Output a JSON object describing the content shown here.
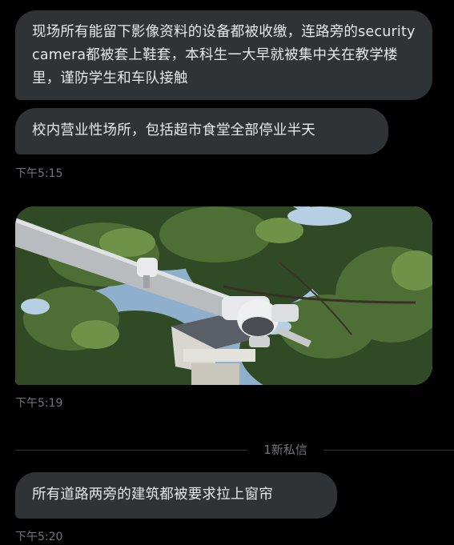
{
  "messages": [
    {
      "text": "现场所有能留下影像资料的设备都被收缴，连路旁的security camera都被套上鞋套，本科生一大早就被集中关在教学楼里，谨防学生和车队接触"
    },
    {
      "text": "校内营业性场所，包括超市食堂全部停业半天",
      "time": "下午5:15"
    },
    {
      "time": "下午5:19"
    },
    {
      "text": "所有道路两旁的建筑都被要求拉上窗帘",
      "time": "下午5:20"
    }
  ],
  "divider": {
    "label": "1新私信"
  },
  "colors": {
    "background": "#000000",
    "bubble": "#2f3336",
    "text": "#e7e9ea",
    "muted": "#71767b"
  }
}
